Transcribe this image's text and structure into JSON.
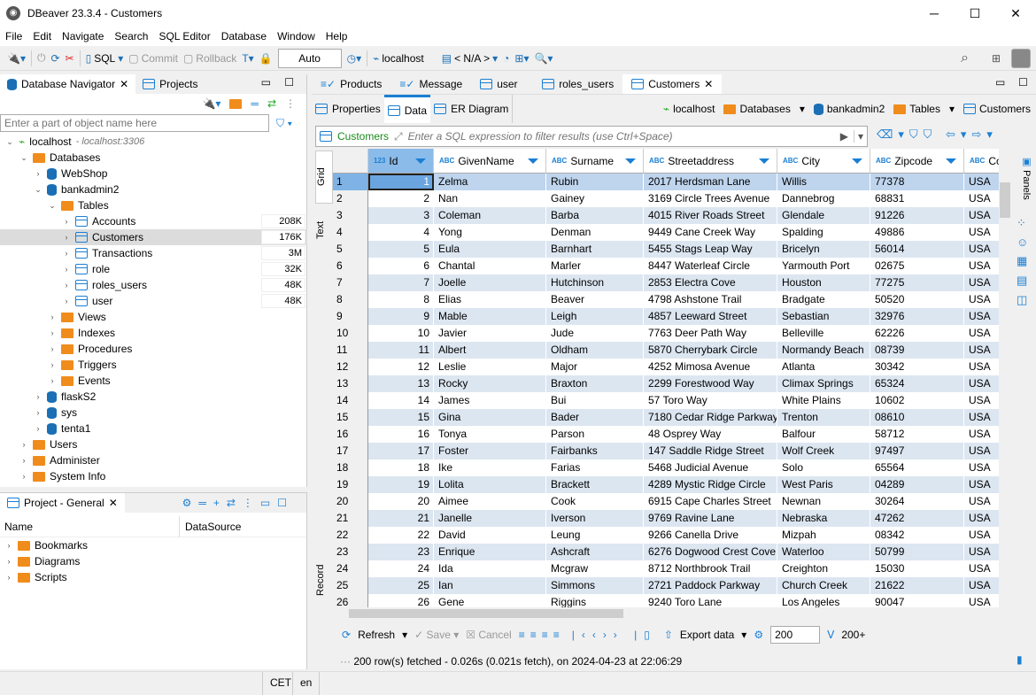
{
  "window": {
    "title": "DBeaver 23.3.4 - Customers",
    "minimize": "─",
    "maximize": "☐",
    "close": "✕"
  },
  "menu": [
    "File",
    "Edit",
    "Navigate",
    "Search",
    "SQL Editor",
    "Database",
    "Window",
    "Help"
  ],
  "toolbar": {
    "sql": "SQL",
    "commit": "Commit",
    "rollback": "Rollback",
    "transaction_mode": "Auto",
    "datasource": "localhost",
    "schema": "< N/A >"
  },
  "navigator": {
    "tabs": [
      "Database Navigator",
      "Projects"
    ],
    "filter_placeholder": "Enter a part of object name here",
    "tree": [
      {
        "label": "localhost",
        "sub": "- localhost:3306",
        "level": 0,
        "open": true,
        "icon": "connection"
      },
      {
        "label": "Databases",
        "level": 1,
        "open": true,
        "icon": "folder"
      },
      {
        "label": "WebShop",
        "level": 2,
        "open": false,
        "icon": "database"
      },
      {
        "label": "bankadmin2",
        "level": 2,
        "open": true,
        "icon": "database"
      },
      {
        "label": "Tables",
        "level": 3,
        "open": true,
        "icon": "folder"
      },
      {
        "label": "Accounts",
        "level": 4,
        "open": false,
        "icon": "table",
        "size": "208K"
      },
      {
        "label": "Customers",
        "level": 4,
        "open": false,
        "icon": "table",
        "size": "176K",
        "selected": true
      },
      {
        "label": "Transactions",
        "level": 4,
        "open": false,
        "icon": "table",
        "size": "3M"
      },
      {
        "label": "role",
        "level": 4,
        "open": false,
        "icon": "table",
        "size": "32K"
      },
      {
        "label": "roles_users",
        "level": 4,
        "open": false,
        "icon": "table",
        "size": "48K"
      },
      {
        "label": "user",
        "level": 4,
        "open": false,
        "icon": "table",
        "size": "48K"
      },
      {
        "label": "Views",
        "level": 3,
        "open": false,
        "icon": "folder"
      },
      {
        "label": "Indexes",
        "level": 3,
        "open": false,
        "icon": "folder"
      },
      {
        "label": "Procedures",
        "level": 3,
        "open": false,
        "icon": "folder"
      },
      {
        "label": "Triggers",
        "level": 3,
        "open": false,
        "icon": "folder"
      },
      {
        "label": "Events",
        "level": 3,
        "open": false,
        "icon": "folder"
      },
      {
        "label": "flaskS2",
        "level": 2,
        "open": false,
        "icon": "database"
      },
      {
        "label": "sys",
        "level": 2,
        "open": false,
        "icon": "database"
      },
      {
        "label": "tenta1",
        "level": 2,
        "open": false,
        "icon": "database"
      },
      {
        "label": "Users",
        "level": 1,
        "open": false,
        "icon": "folder"
      },
      {
        "label": "Administer",
        "level": 1,
        "open": false,
        "icon": "folder"
      },
      {
        "label": "System Info",
        "level": 1,
        "open": false,
        "icon": "folder"
      }
    ]
  },
  "project": {
    "tab": "Project - General",
    "columns": [
      "Name",
      "DataSource"
    ],
    "items": [
      "Bookmarks",
      "Diagrams",
      "Scripts"
    ]
  },
  "editor": {
    "tabs": [
      "Products",
      "Message",
      "user",
      "roles_users",
      "Customers"
    ],
    "active_tab": "Customers",
    "subtabs": [
      "Properties",
      "Data",
      "ER Diagram"
    ],
    "active_subtab": "Data",
    "breadcrumb": [
      "localhost",
      "Databases",
      "bankadmin2",
      "Tables",
      "Customers"
    ],
    "filter": {
      "table": "Customers",
      "placeholder": "Enter a SQL expression to filter results (use Ctrl+Space)"
    },
    "side_tabs": [
      "Grid",
      "Text",
      "Record"
    ],
    "panels_label": "Panels"
  },
  "grid": {
    "columns": [
      "Id",
      "GivenName",
      "Surname",
      "Streetaddress",
      "City",
      "Zipcode",
      "Co"
    ],
    "rows": [
      [
        1,
        "Zelma",
        "Rubin",
        "2017 Herdsman Lane",
        "Willis",
        "77378",
        "USA"
      ],
      [
        2,
        "Nan",
        "Gainey",
        "3169 Circle Trees Avenue",
        "Dannebrog",
        "68831",
        "USA"
      ],
      [
        3,
        "Coleman",
        "Barba",
        "4015 River Roads Street",
        "Glendale",
        "91226",
        "USA"
      ],
      [
        4,
        "Yong",
        "Denman",
        "9449 Cane Creek Way",
        "Spalding",
        "49886",
        "USA"
      ],
      [
        5,
        "Eula",
        "Barnhart",
        "5455 Stags Leap Way",
        "Bricelyn",
        "56014",
        "USA"
      ],
      [
        6,
        "Chantal",
        "Marler",
        "8447 Waterleaf Circle",
        "Yarmouth Port",
        "02675",
        "USA"
      ],
      [
        7,
        "Joelle",
        "Hutchinson",
        "2853 Electra Cove",
        "Houston",
        "77275",
        "USA"
      ],
      [
        8,
        "Elias",
        "Beaver",
        "4798 Ashstone Trail",
        "Bradgate",
        "50520",
        "USA"
      ],
      [
        9,
        "Mable",
        "Leigh",
        "4857 Leeward Street",
        "Sebastian",
        "32976",
        "USA"
      ],
      [
        10,
        "Javier",
        "Jude",
        "7763 Deer Path Way",
        "Belleville",
        "62226",
        "USA"
      ],
      [
        11,
        "Albert",
        "Oldham",
        "5870 Cherrybark Circle",
        "Normandy Beach",
        "08739",
        "USA"
      ],
      [
        12,
        "Leslie",
        "Major",
        "4252 Mimosa Avenue",
        "Atlanta",
        "30342",
        "USA"
      ],
      [
        13,
        "Rocky",
        "Braxton",
        "2299 Forestwood Way",
        "Climax Springs",
        "65324",
        "USA"
      ],
      [
        14,
        "James",
        "Bui",
        "57 Toro Way",
        "White Plains",
        "10602",
        "USA"
      ],
      [
        15,
        "Gina",
        "Bader",
        "7180 Cedar Ridge Parkway",
        "Trenton",
        "08610",
        "USA"
      ],
      [
        16,
        "Tonya",
        "Parson",
        "48 Osprey Way",
        "Balfour",
        "58712",
        "USA"
      ],
      [
        17,
        "Foster",
        "Fairbanks",
        "147 Saddle Ridge Street",
        "Wolf Creek",
        "97497",
        "USA"
      ],
      [
        18,
        "Ike",
        "Farias",
        "5468 Judicial Avenue",
        "Solo",
        "65564",
        "USA"
      ],
      [
        19,
        "Lolita",
        "Brackett",
        "4289 Mystic Ridge Circle",
        "West Paris",
        "04289",
        "USA"
      ],
      [
        20,
        "Aimee",
        "Cook",
        "6915 Cape Charles Street",
        "Newnan",
        "30264",
        "USA"
      ],
      [
        21,
        "Janelle",
        "Iverson",
        "9769 Ravine Lane",
        "Nebraska",
        "47262",
        "USA"
      ],
      [
        22,
        "David",
        "Leung",
        "9266 Canella Drive",
        "Mizpah",
        "08342",
        "USA"
      ],
      [
        23,
        "Enrique",
        "Ashcraft",
        "6276 Dogwood Crest Cove",
        "Waterloo",
        "50799",
        "USA"
      ],
      [
        24,
        "Ida",
        "Mcgraw",
        "8712 Northbrook Trail",
        "Creighton",
        "15030",
        "USA"
      ],
      [
        25,
        "Ian",
        "Simmons",
        "2721 Paddock Parkway",
        "Church Creek",
        "21622",
        "USA"
      ],
      [
        26,
        "Gene",
        "Riggins",
        "9240 Toro Lane",
        "Los Angeles",
        "90047",
        "USA"
      ]
    ]
  },
  "bottom": {
    "refresh": "Refresh",
    "save": "Save",
    "cancel": "Cancel",
    "export": "Export data",
    "fetch_size": "200",
    "fetch_more": "200+",
    "status": "200 row(s) fetched - 0.026s (0.021s fetch), on 2024-04-23 at 22:06:29"
  },
  "statusbar": {
    "timezone": "CET",
    "locale": "en"
  },
  "colors": {
    "accent": "#1a7fd4",
    "row_alt": "#dce6f1",
    "selected_row": "#bfd5ee",
    "folder": "#f08c1c"
  }
}
